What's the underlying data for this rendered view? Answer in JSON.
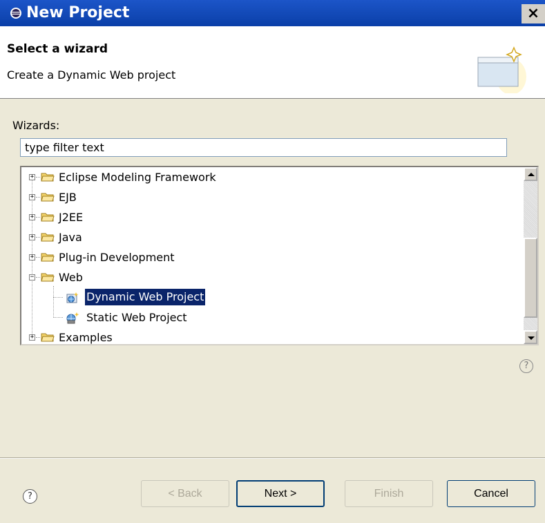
{
  "window": {
    "title": "New Project",
    "close_label": "×",
    "app_icon": "eclipse-icon"
  },
  "header": {
    "title": "Select a wizard",
    "description": "Create a Dynamic Web project",
    "banner_icon": "wizard-banner-icon"
  },
  "wizards": {
    "label": "Wizards:",
    "filter_value": "type filter text",
    "tree": [
      {
        "label": "Eclipse Modeling Framework",
        "type": "folder",
        "expanded": false
      },
      {
        "label": "EJB",
        "type": "folder",
        "expanded": false
      },
      {
        "label": "J2EE",
        "type": "folder",
        "expanded": false
      },
      {
        "label": "Java",
        "type": "folder",
        "expanded": false
      },
      {
        "label": "Plug-in Development",
        "type": "folder",
        "expanded": false
      },
      {
        "label": "Web",
        "type": "folder",
        "expanded": true
      },
      {
        "label": "Dynamic Web Project",
        "type": "item",
        "selected": true
      },
      {
        "label": "Static Web Project",
        "type": "item",
        "selected": false
      },
      {
        "label": "Examples",
        "type": "folder",
        "expanded": false
      }
    ]
  },
  "help": {
    "glyph": "?"
  },
  "buttons": {
    "back": "< Back",
    "next": "Next >",
    "finish": "Finish",
    "cancel": "Cancel"
  },
  "colors": {
    "titlebar": "#0a3fa8",
    "selection": "#0a246a",
    "dialog_bg": "#ece9d8"
  }
}
